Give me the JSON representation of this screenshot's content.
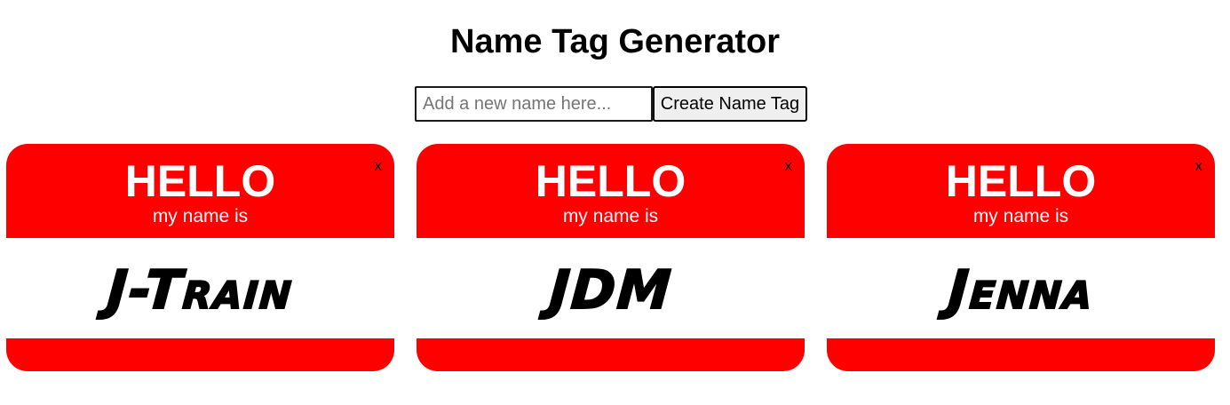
{
  "header": {
    "title": "Name Tag Generator"
  },
  "form": {
    "input_value": "",
    "input_placeholder": "Add a new name here...",
    "button_label": "Create Name Tag"
  },
  "name_tags": [
    {
      "greeting": "HELLO",
      "subtitle": "my name is",
      "name": "J-Train",
      "close_label": "x"
    },
    {
      "greeting": "HELLO",
      "subtitle": "my name is",
      "name": "JDM",
      "close_label": "x"
    },
    {
      "greeting": "HELLO",
      "subtitle": "my name is",
      "name": "Jenna",
      "close_label": "x"
    }
  ],
  "colors": {
    "tag_red": "#ff0000",
    "tag_white": "#ffffff",
    "text_black": "#000000"
  }
}
